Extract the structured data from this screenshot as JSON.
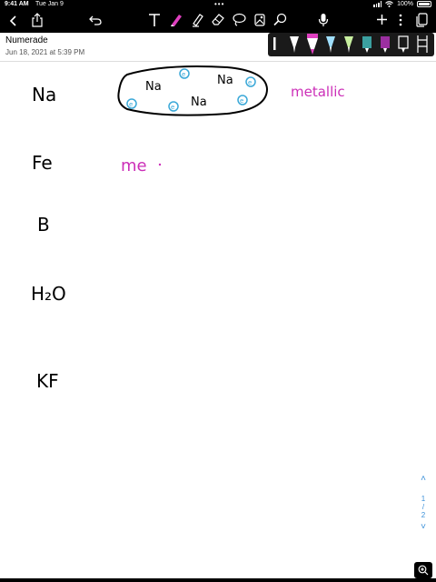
{
  "status_bar": {
    "time": "9:41 AM",
    "date": "Tue Jan 9",
    "battery": "100%"
  },
  "toolbar": {
    "icons": [
      "chevron-left-icon",
      "share-icon",
      "undo-icon",
      "text-tool-icon",
      "pen-tool-icon",
      "highlighter-icon",
      "eraser-icon",
      "lasso-icon",
      "image-icon",
      "magnifier-icon",
      "microphone-icon",
      "add-page-icon",
      "more-icon",
      "pages-icon"
    ]
  },
  "document": {
    "title": "Numerade",
    "date": "Jun 18, 2021 at 5:39 PM"
  },
  "pen_palette": {
    "colors": [
      "#ffffff",
      "#e040c0",
      "#a0e0ff",
      "#c8f0a0",
      "#3ba0a0",
      "#9b2fa0",
      "#ffffff"
    ]
  },
  "handwriting": {
    "elements": [
      "Na",
      "Fe",
      "B",
      "H₂O",
      "KF"
    ],
    "sea_labels": [
      "Na",
      "Na",
      "Na"
    ],
    "electron_mark": "e",
    "metallic_label": "metallic",
    "fe_partial": "me",
    "ink_black": "#000000",
    "ink_magenta": "#cc2fb8",
    "ink_cyan": "#3aa8d8"
  },
  "pager": {
    "up": "˄",
    "current": "1",
    "divider": "/",
    "total": "2",
    "down": "˅"
  },
  "zoom_icon": "zoom-icon"
}
